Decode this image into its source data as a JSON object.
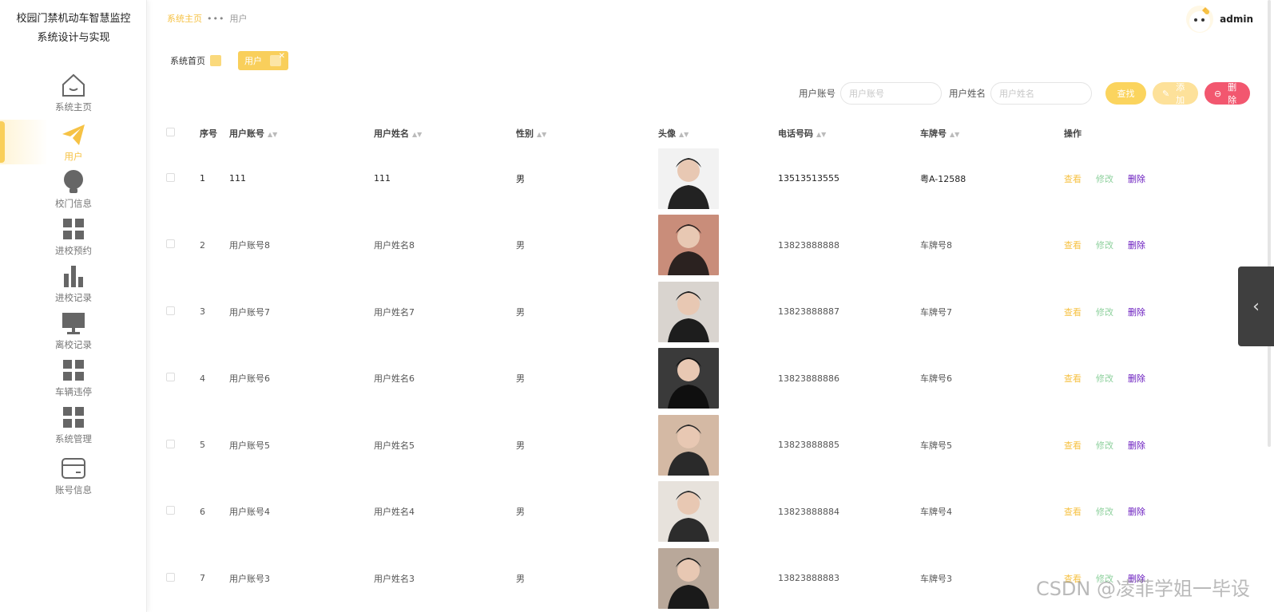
{
  "app": {
    "title_line1": "校园门禁机动车智慧监控",
    "title_line2": "系统设计与实现"
  },
  "sidebar": {
    "items": [
      {
        "label": "系统主页",
        "icon": "home-icon"
      },
      {
        "label": "用户",
        "icon": "paper-plane-icon",
        "active": true
      },
      {
        "label": "校门信息",
        "icon": "lightbulb-icon"
      },
      {
        "label": "进校预约",
        "icon": "grid-icon"
      },
      {
        "label": "进校记录",
        "icon": "bar-chart-icon"
      },
      {
        "label": "离校记录",
        "icon": "monitor-icon"
      },
      {
        "label": "车辆违停",
        "icon": "grid-icon"
      },
      {
        "label": "系统管理",
        "icon": "grid-icon"
      },
      {
        "label": "账号信息",
        "icon": "card-icon"
      }
    ]
  },
  "breadcrumb": {
    "home": "系统主页",
    "current": "用户"
  },
  "header": {
    "username": "admin"
  },
  "tags": {
    "home": "系统首页",
    "active": "用户"
  },
  "search": {
    "account_label": "用户账号",
    "account_placeholder": "用户账号",
    "name_label": "用户姓名",
    "name_placeholder": "用户姓名",
    "search_button": "查找",
    "add_button": "添加",
    "delete_button": "删除"
  },
  "table": {
    "headers": [
      "序号",
      "用户账号",
      "用户姓名",
      "性别",
      "头像",
      "电话号码",
      "车牌号",
      "操作"
    ],
    "actions": {
      "view": "查看",
      "edit": "修改",
      "delete": "删除"
    },
    "rows": [
      {
        "no": "1",
        "account": "111",
        "name": "111",
        "gender": "男",
        "phone": "13513513555",
        "plate": "粤A-12588"
      },
      {
        "no": "2",
        "account": "用户账号8",
        "name": "用户姓名8",
        "gender": "男",
        "phone": "13823888888",
        "plate": "车牌号8"
      },
      {
        "no": "3",
        "account": "用户账号7",
        "name": "用户姓名7",
        "gender": "男",
        "phone": "13823888887",
        "plate": "车牌号7"
      },
      {
        "no": "4",
        "account": "用户账号6",
        "name": "用户姓名6",
        "gender": "男",
        "phone": "13823888886",
        "plate": "车牌号6"
      },
      {
        "no": "5",
        "account": "用户账号5",
        "name": "用户姓名5",
        "gender": "男",
        "phone": "13823888885",
        "plate": "车牌号5"
      },
      {
        "no": "6",
        "account": "用户账号4",
        "name": "用户姓名4",
        "gender": "男",
        "phone": "13823888884",
        "plate": "车牌号4"
      },
      {
        "no": "7",
        "account": "用户账号3",
        "name": "用户姓名3",
        "gender": "男",
        "phone": "13823888883",
        "plate": "车牌号3"
      }
    ]
  },
  "watermark": "CSDN @凌菲学姐一毕设",
  "colors": {
    "accent": "#f9cf5b",
    "danger": "#f2576f",
    "delete_link": "#6a1cbf",
    "edit_link": "#8fd19e"
  }
}
